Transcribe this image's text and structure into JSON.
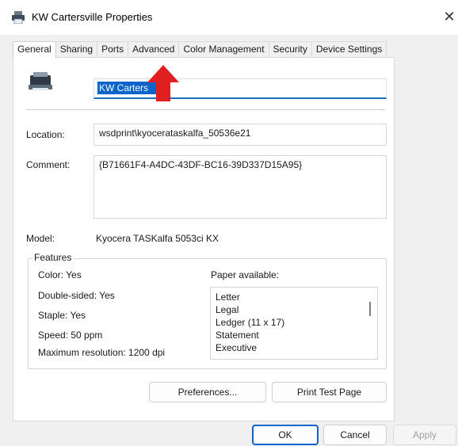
{
  "window": {
    "title": "KW Cartersville Properties",
    "close_glyph": "✕"
  },
  "tabs": [
    {
      "label": "General",
      "active": true
    },
    {
      "label": "Sharing"
    },
    {
      "label": "Ports"
    },
    {
      "label": "Advanced"
    },
    {
      "label": "Color Management"
    },
    {
      "label": "Security"
    },
    {
      "label": "Device Settings"
    }
  ],
  "general": {
    "printer_name": "KW Cartersville",
    "printer_name_visible": "KW Carters",
    "location_label": "Location:",
    "location_value": "wsdprint\\kyocerataskalfa_50536e21",
    "comment_label": "Comment:",
    "comment_value": "{B71661F4-A4DC-43DF-BC16-39D337D15A95}",
    "model_label": "Model:",
    "model_value": "Kyocera TASKalfa 5053ci KX"
  },
  "features": {
    "title": "Features",
    "color": "Color: Yes",
    "double_sided": "Double-sided: Yes",
    "staple": "Staple: Yes",
    "speed": "Speed: 50 ppm",
    "max_resolution": "Maximum resolution: 1200 dpi",
    "paper_label": "Paper available:",
    "paper": [
      "Letter",
      "Legal",
      "Ledger (11 x 17)",
      "Statement",
      "Executive"
    ]
  },
  "buttons": {
    "preferences": "Preferences...",
    "print_test_page": "Print Test Page",
    "ok": "OK",
    "cancel": "Cancel",
    "apply": "Apply"
  },
  "icons": {
    "app": "printer-icon",
    "printer": "printer-icon",
    "arrow": "red-arrow-icon",
    "close": "close-icon"
  },
  "colors": {
    "accent": "#0a64c9",
    "arrow": "#e02020"
  }
}
